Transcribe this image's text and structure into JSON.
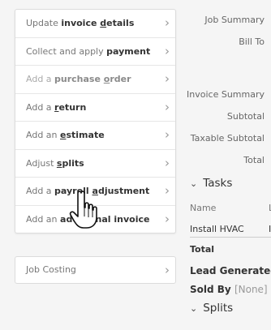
{
  "menu": {
    "items": [
      {
        "pre": "Update ",
        "b1": "invoice ",
        "u": "d",
        "b2": "etails",
        "disabled": false
      },
      {
        "pre": "Collect and apply ",
        "b1": "",
        "u": "",
        "b2": "payment",
        "disabled": false
      },
      {
        "pre": "Add a ",
        "b1": "purchase ",
        "u": "o",
        "b2": "rder",
        "disabled": true
      },
      {
        "pre": "Add a ",
        "b1": "",
        "u": "r",
        "b2": "eturn",
        "disabled": false
      },
      {
        "pre": "Add an ",
        "b1": "",
        "u": "e",
        "b2": "stimate",
        "disabled": false
      },
      {
        "pre": "Adjust ",
        "b1": "",
        "u": "s",
        "b2": "plits",
        "disabled": false
      },
      {
        "pre": "Add a ",
        "b1": "payroll ",
        "u": "a",
        "b2": "djustment",
        "disabled": false
      },
      {
        "pre": "Add an ",
        "b1": "additional ",
        "u": "",
        "b2": "invoice",
        "disabled": false
      }
    ],
    "job_costing": "Job Costing"
  },
  "summary": {
    "job_summary": "Job Summary",
    "bill_to": "Bill To",
    "invoice_summary": "Invoice Summary",
    "subtotal": "Subtotal",
    "taxable_subtotal": "Taxable Subtotal",
    "total": "Total"
  },
  "tasks": {
    "title": "Tasks",
    "name_col": "Name",
    "col2": "L",
    "row_name": "Install HVAC",
    "row_col2": "I",
    "total": "Total"
  },
  "lead": {
    "lead_generated": "Lead Generated",
    "sold_by": "Sold By",
    "sold_by_value": "[None]"
  },
  "splits": {
    "title": "Splits"
  },
  "icons": {
    "chevron": "chevron-right-icon",
    "caret": "chevron-down-icon",
    "cursor": "hand-pointer-icon"
  }
}
